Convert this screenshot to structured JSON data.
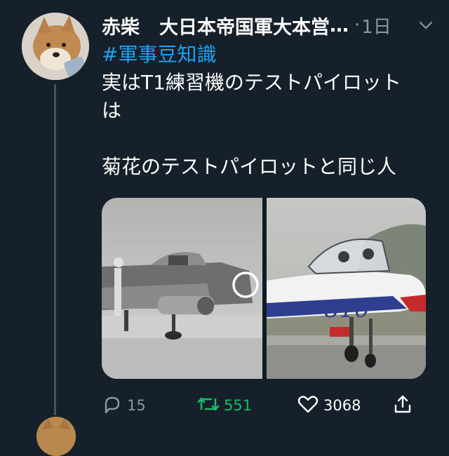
{
  "tweet": {
    "author_name": "赤柴",
    "author_handle": "大日本帝国軍大本営",
    "separator": "·",
    "timestamp": "1日",
    "hashtag": "#軍事豆知識",
    "body_line_1": "実はT1練習機のテストパイロット",
    "body_line_2": "は",
    "body_line_3": "菊花のテストパイロットと同じ人",
    "icons": {
      "menu": "chevron-down-icon",
      "reply": "reply-icon",
      "retweet": "retweet-icon",
      "like": "heart-icon",
      "share": "share-icon"
    },
    "counts": {
      "replies": "15",
      "retweets": "551",
      "likes": "3068"
    },
    "colors": {
      "background": "#15202b",
      "hashtag": "#1da1f2",
      "retweet_active": "#17bf63",
      "muted": "#8899a6"
    }
  }
}
